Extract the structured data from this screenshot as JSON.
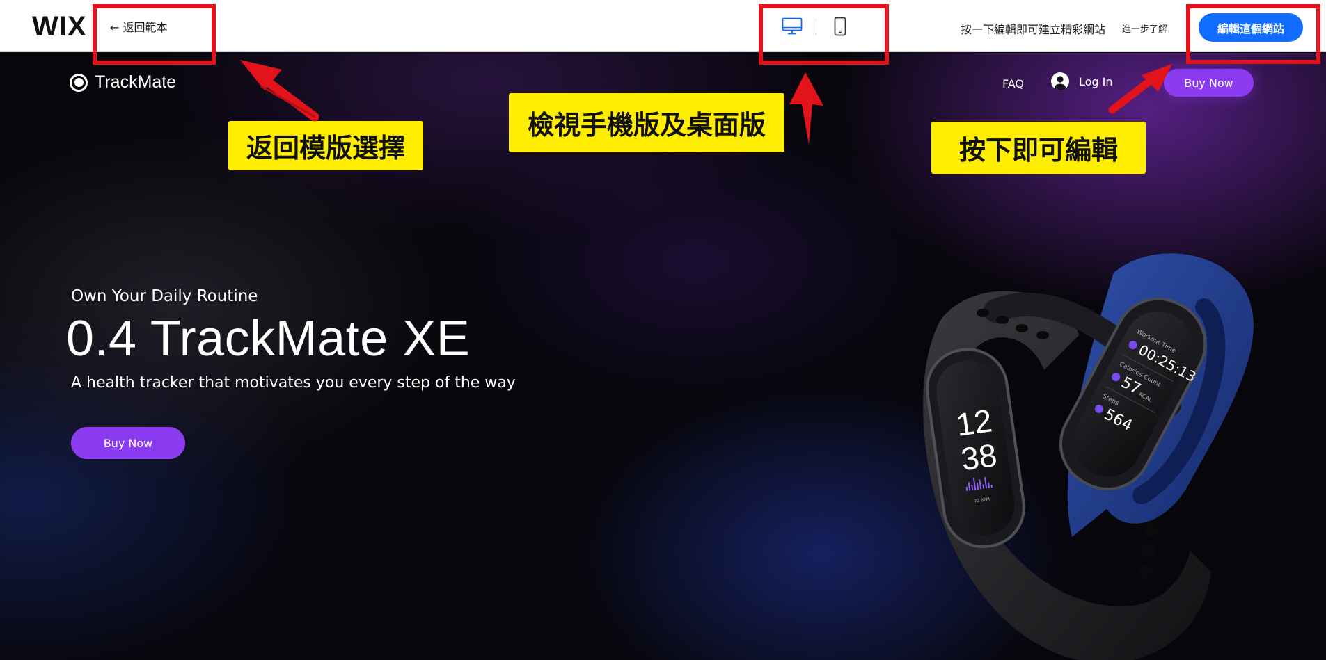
{
  "wix_bar": {
    "logo": "WIX",
    "back_link": "← 返回範本",
    "device_toggle": {
      "desktop_icon": "desktop-icon",
      "mobile_icon": "mobile-phone-icon",
      "selected": "desktop"
    },
    "tagline": "按一下編輯即可建立精彩網站",
    "learn_more": "進一步了解",
    "edit_button": "編輯這個網站"
  },
  "site": {
    "logo_text": "TrackMate",
    "nav": {
      "faq": "FAQ",
      "login": "Log In",
      "buy": "Buy Now"
    },
    "hero": {
      "kicker": "Own Your Daily Routine",
      "title": "0.4 TrackMate XE",
      "subtitle": "A health tracker that motivates you every step of the way",
      "buy": "Buy Now"
    },
    "product_screens": {
      "front": {
        "hour": "12",
        "minute": "38",
        "bpm": "72 BPM"
      },
      "back": {
        "workout_label": "Workout Time",
        "workout_value": "00:25:13",
        "calories_label": "Calories Count",
        "calories_value": "57",
        "calories_unit": "KCAL",
        "steps_label": "Steps",
        "steps_value": "564"
      }
    }
  },
  "annotations": {
    "back_callout": "返回模版選擇",
    "device_callout": "檢視手機版及桌面版",
    "edit_callout": "按下即可編輯"
  },
  "colors": {
    "wix_blue": "#116dff",
    "site_purple": "#8c3cf0",
    "highlight_red": "#e3131b",
    "callout_yellow": "#ffee00"
  }
}
